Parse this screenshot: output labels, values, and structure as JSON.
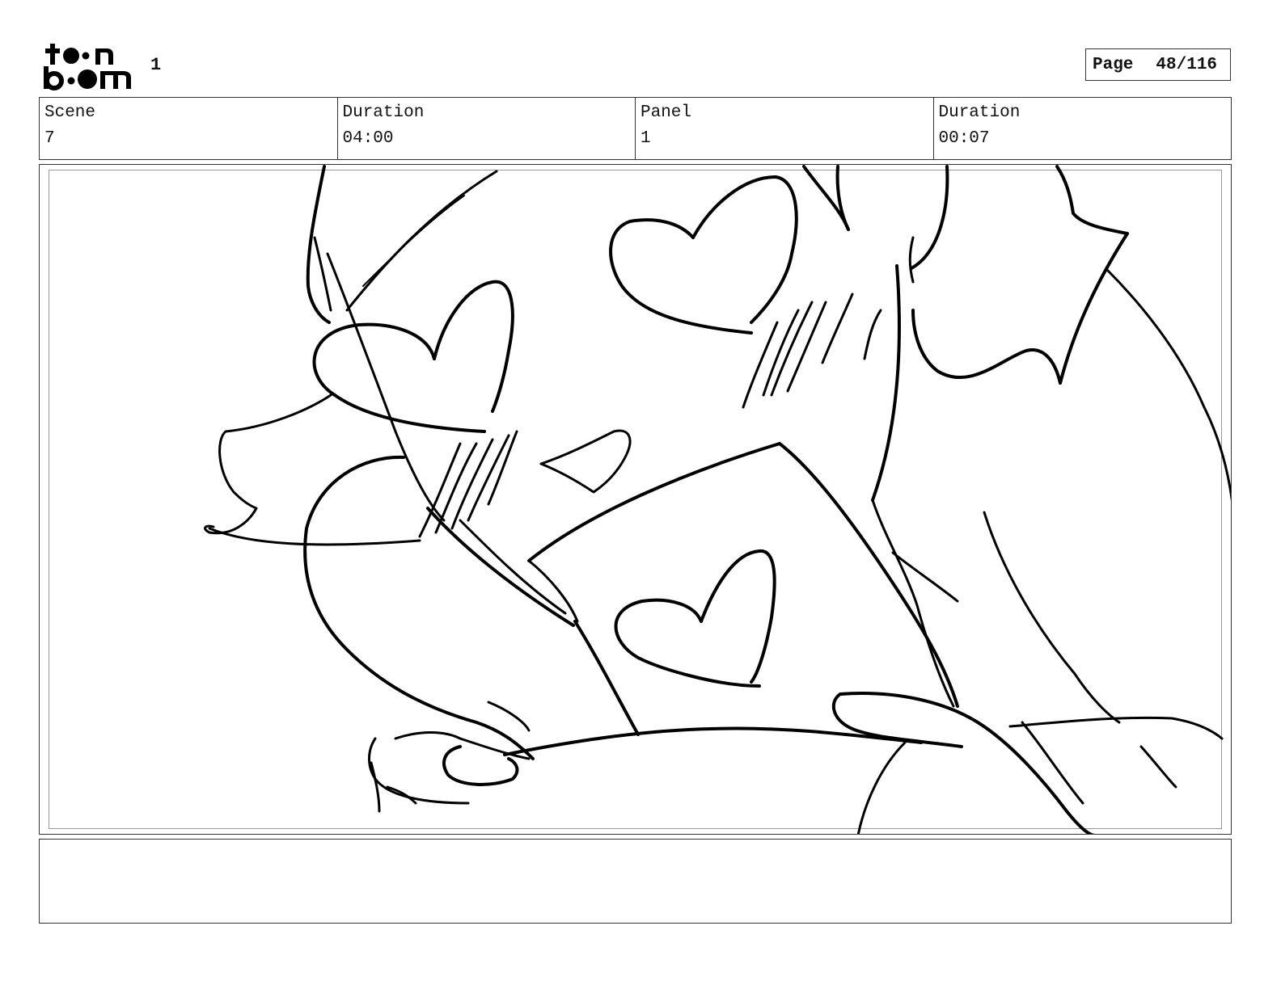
{
  "header": {
    "logo": {
      "icon": "toonboom-logo",
      "text_line1": "to•n",
      "text_line2": "b•om"
    },
    "project_number": "1",
    "page": {
      "label": "Page",
      "value": "48/116"
    }
  },
  "info": {
    "scene_label": "Scene",
    "scene_value": "7",
    "scene_duration_label": "Duration",
    "scene_duration_value": "04:00",
    "panel_label": "Panel",
    "panel_value": "1",
    "panel_duration_label": "Duration",
    "panel_duration_value": "00:07"
  },
  "panel": {
    "image": "sketch-characters-hearts-icon"
  },
  "notes": {
    "text": ""
  }
}
